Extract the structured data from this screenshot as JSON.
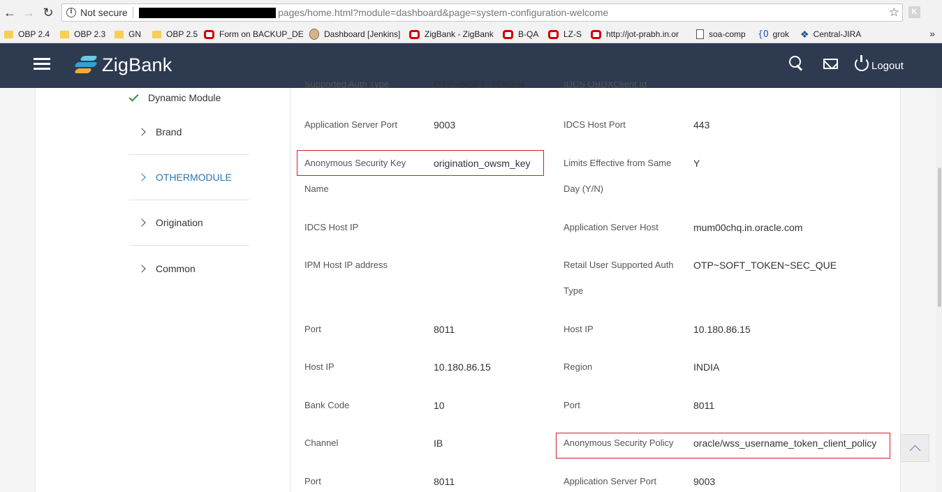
{
  "browser": {
    "security_label": "Not secure",
    "url": "pages/home.html?module=dashboard&page=system-configuration-welcome",
    "extension_label": "K",
    "bookmarks": [
      {
        "label": "OBP 2.4",
        "icon": "folder-icon"
      },
      {
        "label": "OBP 2.3",
        "icon": "folder-icon"
      },
      {
        "label": "GN",
        "icon": "folder-icon"
      },
      {
        "label": "OBP 2.5",
        "icon": "folder-icon"
      },
      {
        "label": "Form on BACKUP_DE",
        "icon": "oracle-icon"
      },
      {
        "label": "Dashboard [Jenkins]",
        "icon": "jenkins-icon"
      },
      {
        "label": "ZigBank - ZigBank",
        "icon": "oracle-icon"
      },
      {
        "label": "B-QA",
        "icon": "oracle-icon"
      },
      {
        "label": "LZ-S",
        "icon": "oracle-icon"
      },
      {
        "label": "http://jot-prabh.in.or",
        "icon": "oracle-icon"
      },
      {
        "label": "soa-comp",
        "icon": "page-icon"
      },
      {
        "label": "grok",
        "icon": "grok-icon"
      },
      {
        "label": "Central-JIRA",
        "icon": "jira-icon"
      }
    ],
    "bookmarks_more": "»"
  },
  "header": {
    "brand": "ZigBank",
    "logout_label": "Logout"
  },
  "sidebar": {
    "completed_item": "Dynamic Module",
    "items": [
      {
        "label": "Brand"
      },
      {
        "label": "OTHERMODULE"
      },
      {
        "label": "Origination"
      },
      {
        "label": "Common"
      }
    ]
  },
  "config": {
    "top_left_label_partial": "Supported Auth Type",
    "top_left_value_partial": "OTP~SOFT_TOKEN",
    "top_right_label_partial": "IDCS OBDXClient Id",
    "rows": [
      {
        "left_label": "Application Server Port",
        "left_value": "9003",
        "right_label": "IDCS Host Port",
        "right_value": "443"
      },
      {
        "left_label": "Anonymous Security Key",
        "left_label_cont": "Name",
        "left_value": "origination_owsm_key",
        "right_label": "Limits Effective from Same",
        "right_label_cont": "Day (Y/N)",
        "right_value": "Y"
      },
      {
        "left_label": "IDCS Host IP",
        "left_value": "",
        "right_label": "Application Server Host",
        "right_value": "mum00chq.in.oracle.com"
      },
      {
        "left_label": "IPM Host IP address",
        "left_value": "",
        "right_label": "Retail User Supported Auth",
        "right_label_cont": "Type",
        "right_value": "OTP~SOFT_TOKEN~SEC_QUE"
      },
      {
        "left_label": "Port",
        "left_value": "8011",
        "right_label": "Host IP",
        "right_value": "10.180.86.15"
      },
      {
        "left_label": "Host IP",
        "left_value": "10.180.86.15",
        "right_label": "Region",
        "right_value": "INDIA"
      },
      {
        "left_label": "Bank Code",
        "left_value": "10",
        "right_label": "Port",
        "right_value": "8011"
      },
      {
        "left_label": "Channel",
        "left_value": "IB",
        "right_label": "Anonymous Security Policy",
        "right_value": "oracle/wss_username_token_client_policy"
      },
      {
        "left_label": "Port",
        "left_value": "8011",
        "right_label": "Application Server Port",
        "right_value": "9003"
      }
    ]
  },
  "colors": {
    "header_bg": "#2d3a50",
    "active_nav": "#2775b5",
    "highlight_border": "#d01f26",
    "check_green": "#3a8b3a"
  }
}
